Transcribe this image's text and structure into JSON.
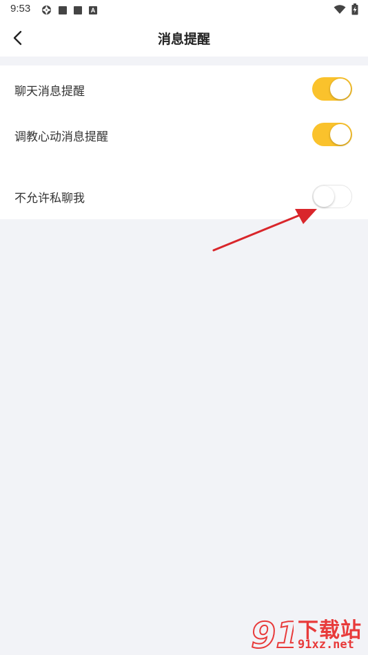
{
  "status_bar": {
    "time": "9:53",
    "left_icons": [
      "aperture-icon",
      "square-icon",
      "square-icon",
      "a-icon"
    ],
    "a_label": "A",
    "right_icons": [
      "wifi-icon",
      "battery-charging-icon"
    ]
  },
  "header": {
    "title": "消息提醒",
    "back_icon": "chevron-left-icon"
  },
  "settings": {
    "items": [
      {
        "label": "聊天消息提醒",
        "enabled": true
      },
      {
        "label": "调教心动消息提醒",
        "enabled": true
      },
      {
        "label": "不允许私聊我",
        "enabled": false
      }
    ]
  },
  "colors": {
    "toggle_on": "#fac22c",
    "background": "#f2f3f7",
    "arrow": "#d9262b",
    "watermark": "#e83a3a"
  },
  "watermark": {
    "logo_text": "91",
    "title": "下载站",
    "url": "91xz.net"
  }
}
